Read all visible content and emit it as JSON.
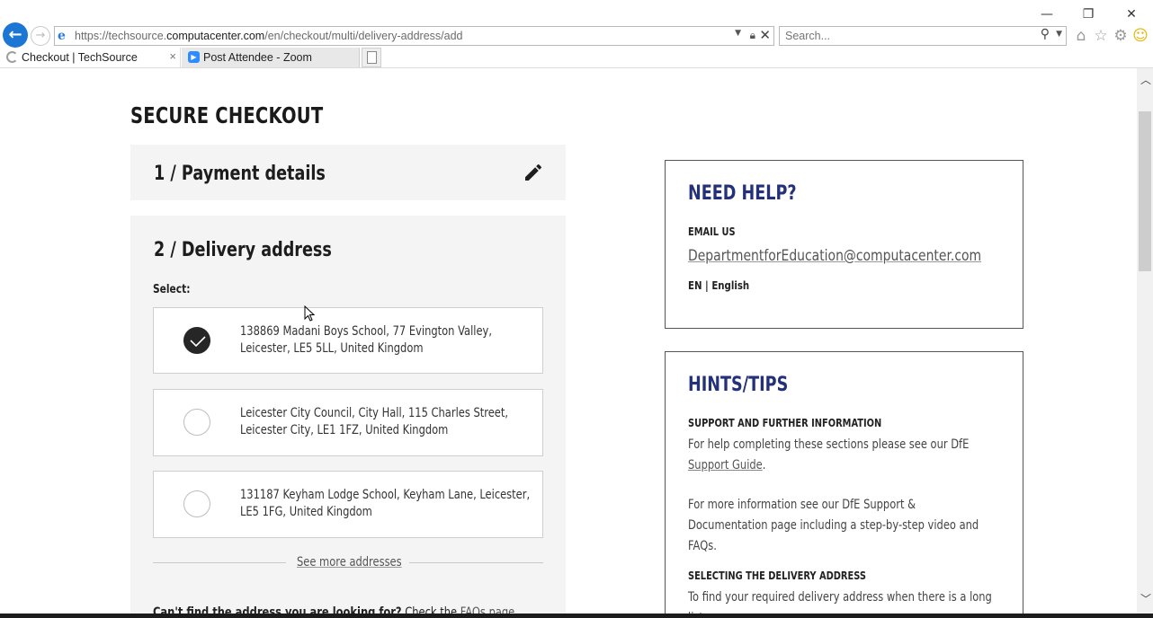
{
  "window": {
    "minimize_icon": "minimize-icon",
    "restore_icon": "restore-icon",
    "close_icon": "close-icon"
  },
  "browser": {
    "url_prefix": "https://techsource.",
    "url_domain": "computacenter.com",
    "url_path": "/en/checkout/multi/delivery-address/add",
    "search_placeholder": "Search...",
    "tabs": [
      {
        "label": "Checkout | TechSource",
        "icon": "loading-icon",
        "active": true
      },
      {
        "label": "Post Attendee - Zoom",
        "icon": "zoom-icon",
        "active": false
      }
    ]
  },
  "page": {
    "title": "SECURE CHECKOUT",
    "payment": {
      "title": "1 / Payment details"
    },
    "delivery": {
      "title": "2 / Delivery address",
      "select_label": "Select:",
      "addresses": [
        {
          "line1": "138869 Madani Boys School, 77 Evington Valley,",
          "line2": "Leicester, LE5 5LL, United Kingdom",
          "selected": true
        },
        {
          "line1": "Leicester City Council, City Hall, 115 Charles Street,",
          "line2": "Leicester City, LE1 1FZ, United Kingdom",
          "selected": false
        },
        {
          "line1": "131187 Keyham Lodge School, Keyham Lane, Leicester,",
          "line2": "LE5 1FG, United Kingdom",
          "selected": false
        }
      ],
      "see_more": "See more addresses",
      "cant_find_bold": "Can't find the address you are looking for?",
      "cant_find_text": " Check the ",
      "cant_find_link": "FAQs page"
    },
    "help": {
      "title": "NEED HELP?",
      "email_label": "EMAIL US",
      "email": "DepartmentforEducation@computacenter.com",
      "language": "EN | English"
    },
    "hints": {
      "title": "HINTS/TIPS",
      "support_label": "SUPPORT AND FURTHER INFORMATION",
      "para1_text": "For help completing these sections please see our DfE ",
      "para1_link": "Support Guide",
      "para1_end": ".",
      "para2": "For more information see our DfE Support & Documentation page including a step-by-step video and FAQs.",
      "select_label": "SELECTING THE DELIVERY ADDRESS",
      "para3": "To find your required delivery address when there is a long list"
    }
  },
  "colors": {
    "heading_blue": "#23307a",
    "panel_bg": "#f4f4f5",
    "ie_blue": "#1b77d3"
  }
}
